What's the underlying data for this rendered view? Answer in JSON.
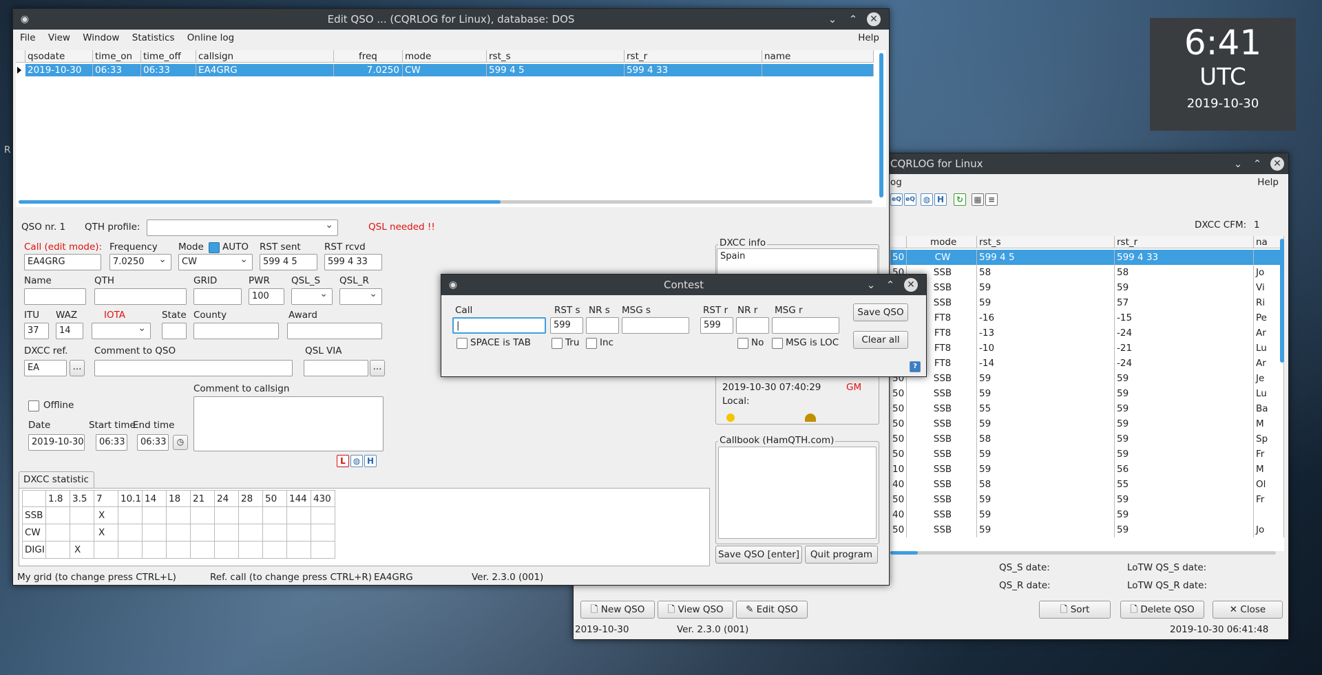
{
  "clock": {
    "time": "6:41",
    "zone": "UTC",
    "date": "2019-10-30"
  },
  "desktop": {
    "edge_text": "R"
  },
  "main_window": {
    "title": "CQRLOG for Linux",
    "menu": {
      "log": "og",
      "help": "Help"
    },
    "dxcc_cfm_label": "DXCC CFM:",
    "dxcc_cfm_value": "1",
    "columns": [
      "mode",
      "rst_s",
      "rst_r",
      "na"
    ],
    "rows": [
      {
        "nr": "50",
        "mode": "CW",
        "rst_s": "599 4 5",
        "rst_r": "599 4 33",
        "name": "",
        "selected": true
      },
      {
        "nr": "50",
        "mode": "SSB",
        "rst_s": "58",
        "rst_r": "58",
        "name": "Jo"
      },
      {
        "nr": "50",
        "mode": "SSB",
        "rst_s": "59",
        "rst_r": "59",
        "name": "Vi"
      },
      {
        "nr": "50",
        "mode": "SSB",
        "rst_s": "59",
        "rst_r": "57",
        "name": "Ri"
      },
      {
        "nr": "50",
        "mode": "FT8",
        "rst_s": "-16",
        "rst_r": "-15",
        "name": "Pe"
      },
      {
        "nr": "50",
        "mode": "FT8",
        "rst_s": "-13",
        "rst_r": "-24",
        "name": "Ar"
      },
      {
        "nr": "50",
        "mode": "FT8",
        "rst_s": "-10",
        "rst_r": "-21",
        "name": "Lu"
      },
      {
        "nr": "50",
        "mode": "FT8",
        "rst_s": "-14",
        "rst_r": "-24",
        "name": "Ar"
      },
      {
        "nr": "50",
        "mode": "SSB",
        "rst_s": "59",
        "rst_r": "59",
        "name": "Je"
      },
      {
        "nr": "50",
        "mode": "SSB",
        "rst_s": "59",
        "rst_r": "59",
        "name": "Lu"
      },
      {
        "nr": "50",
        "mode": "SSB",
        "rst_s": "55",
        "rst_r": "59",
        "name": "Ba"
      },
      {
        "nr": "50",
        "mode": "SSB",
        "rst_s": "59",
        "rst_r": "59",
        "name": "M"
      },
      {
        "nr": "50",
        "mode": "SSB",
        "rst_s": "58",
        "rst_r": "59",
        "name": "Sp"
      },
      {
        "nr": "50",
        "mode": "SSB",
        "rst_s": "59",
        "rst_r": "59",
        "name": "Fr"
      },
      {
        "nr": "10",
        "mode": "SSB",
        "rst_s": "59",
        "rst_r": "56",
        "name": "M"
      },
      {
        "nr": "40",
        "mode": "SSB",
        "rst_s": "58",
        "rst_r": "55",
        "name": "Ol"
      },
      {
        "nr": "50",
        "mode": "SSB",
        "rst_s": "59",
        "rst_r": "59",
        "name": "Fr"
      },
      {
        "nr": "40",
        "mode": "SSB",
        "rst_s": "59",
        "rst_r": "59",
        "name": ""
      },
      {
        "nr": "50",
        "mode": "SSB",
        "rst_s": "59",
        "rst_r": "59",
        "name": "Jo"
      }
    ],
    "qs_s_date": "QS_S date:",
    "qs_r_date": "QS_R date:",
    "lotw_qs_s_date": "LoTW QS_S date:",
    "lotw_qs_r_date": "LoTW QS_R date:",
    "buttons": {
      "new_qso": "New QSO",
      "view_qso": "View QSO",
      "edit_qso": "Edit QSO",
      "sort": "Sort",
      "delete_qso": "Delete QSO",
      "close": "Close"
    },
    "status_date": "2019-10-30",
    "status_ver": "Ver. 2.3.0 (001)",
    "status_datetime": "2019-10-30  06:41:48"
  },
  "edit_window": {
    "title": "Edit QSO ... (CQRLOG for Linux), database: DOS",
    "menu": {
      "file": "File",
      "view": "View",
      "window": "Window",
      "statistics": "Statistics",
      "online_log": "Online log",
      "help": "Help"
    },
    "columns": [
      "qsodate",
      "time_on",
      "time_off",
      "callsign",
      "freq",
      "mode",
      "rst_s",
      "rst_r",
      "name"
    ],
    "row": {
      "qsodate": "2019-10-30",
      "time_on": "06:33",
      "time_off": "06:33",
      "callsign": "EA4GRG",
      "freq": "7.0250",
      "mode": "CW",
      "rst_s": "599 4 5",
      "rst_r": "599 4 33",
      "name": ""
    },
    "qso_nr": "QSO nr. 1",
    "qth_profile_label": "QTH profile:",
    "qsl_needed": "QSL needed !!",
    "labels": {
      "call": "Call (edit mode):",
      "frequency": "Frequency",
      "mode": "Mode",
      "auto": "AUTO",
      "rst_sent": "RST sent",
      "rst_rcvd": "RST rcvd",
      "name": "Name",
      "qth": "QTH",
      "grid": "GRID",
      "pwr": "PWR",
      "qsl_s": "QSL_S",
      "qsl_r": "QSL_R",
      "itu": "ITU",
      "waz": "WAZ",
      "iota": "IOTA",
      "state": "State",
      "county": "County",
      "award": "Award",
      "dxcc_ref": "DXCC ref.",
      "comment_qso": "Comment to QSO",
      "qsl_via": "QSL VIA",
      "offline": "Offline",
      "comment_call": "Comment to callsign",
      "date": "Date",
      "start_time": "Start time",
      "end_time": "End time"
    },
    "values": {
      "call": "EA4GRG",
      "frequency": "7.0250",
      "mode": "CW",
      "rst_sent": "599 4 5",
      "rst_rcvd": "599 4 33",
      "pwr": "100",
      "itu": "37",
      "waz": "14",
      "dxcc_ref": "EA",
      "date": "2019-10-30",
      "start_time": "06:33",
      "end_time": "06:33"
    },
    "dxcc_info_label": "DXCC info",
    "dxcc_info_value": "Spain",
    "dxcc_datetime": "2019-10-30  07:40:29",
    "dxcc_tz": "GM",
    "local_label": "Local:",
    "callbook_label": "Callbook (HamQTH.com)",
    "save_qso": "Save QSO [enter]",
    "quit": "Quit program",
    "dxcc_tab": "DXCC statistic",
    "bands": [
      "1.8",
      "3.5",
      "7",
      "10.1",
      "14",
      "18",
      "21",
      "24",
      "28",
      "50",
      "144",
      "430"
    ],
    "stat_rows": [
      {
        "mode": "SSB",
        "marks": [
          "",
          "",
          "X",
          "",
          "",
          "",
          "",
          "",
          "",
          "",
          "",
          ""
        ]
      },
      {
        "mode": "CW",
        "marks": [
          "",
          "",
          "X",
          "",
          "",
          "",
          "",
          "",
          "",
          "",
          "",
          ""
        ]
      },
      {
        "mode": "DIGI",
        "marks": [
          "",
          "X",
          "",
          "",
          "",
          "",
          "",
          "",
          "",
          "",
          "",
          ""
        ]
      }
    ],
    "status": {
      "grid": "My grid (to change press CTRL+L)",
      "ref": "Ref. call (to change press CTRL+R)",
      "call": "EA4GRG",
      "ver": "Ver. 2.3.0 (001)"
    }
  },
  "contest": {
    "title": "Contest",
    "labels": {
      "call": "Call",
      "rst_s": "RST s",
      "nr_s": "NR s",
      "msg_s": "MSG s",
      "rst_r": "RST r",
      "nr_r": "NR r",
      "msg_r": "MSG r"
    },
    "values": {
      "rst_s": "599",
      "rst_r": "599"
    },
    "checks": {
      "space_tab": "SPACE is TAB",
      "tru": "Tru",
      "inc": "Inc",
      "no": "No",
      "msg_loc": "MSG is LOC"
    },
    "save": "Save QSO",
    "clear": "Clear all"
  }
}
